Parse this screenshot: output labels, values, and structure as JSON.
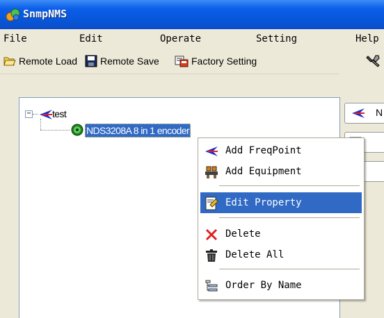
{
  "window": {
    "title": "SnmpNMS"
  },
  "menubar": {
    "items": [
      "File",
      "Edit",
      "Operate",
      "Setting",
      "Help"
    ]
  },
  "toolbar": {
    "remote_load": "Remote Load",
    "remote_save": "Remote Save",
    "factory_setting": "Factory Setting"
  },
  "tree": {
    "root_label": "test",
    "child_label": "NDS3208A 8 in 1 encoder"
  },
  "right_tabs": {
    "first_tab_text": "N"
  },
  "context_menu": {
    "items": [
      {
        "label": "Add FreqPoint",
        "icon": "freqpoint-arrow-icon"
      },
      {
        "label": "Add Equipment",
        "icon": "equipment-icon"
      },
      {
        "label": "Edit Property",
        "icon": "edit-property-icon",
        "highlighted": true
      },
      {
        "label": "Delete",
        "icon": "delete-x-icon"
      },
      {
        "label": "Delete All",
        "icon": "trash-icon"
      },
      {
        "label": "Order By Name",
        "icon": "order-list-icon"
      }
    ]
  },
  "colors": {
    "titlebar": "#0a5ee9",
    "selection": "#316ac5",
    "window_bg": "#ece9d8"
  }
}
